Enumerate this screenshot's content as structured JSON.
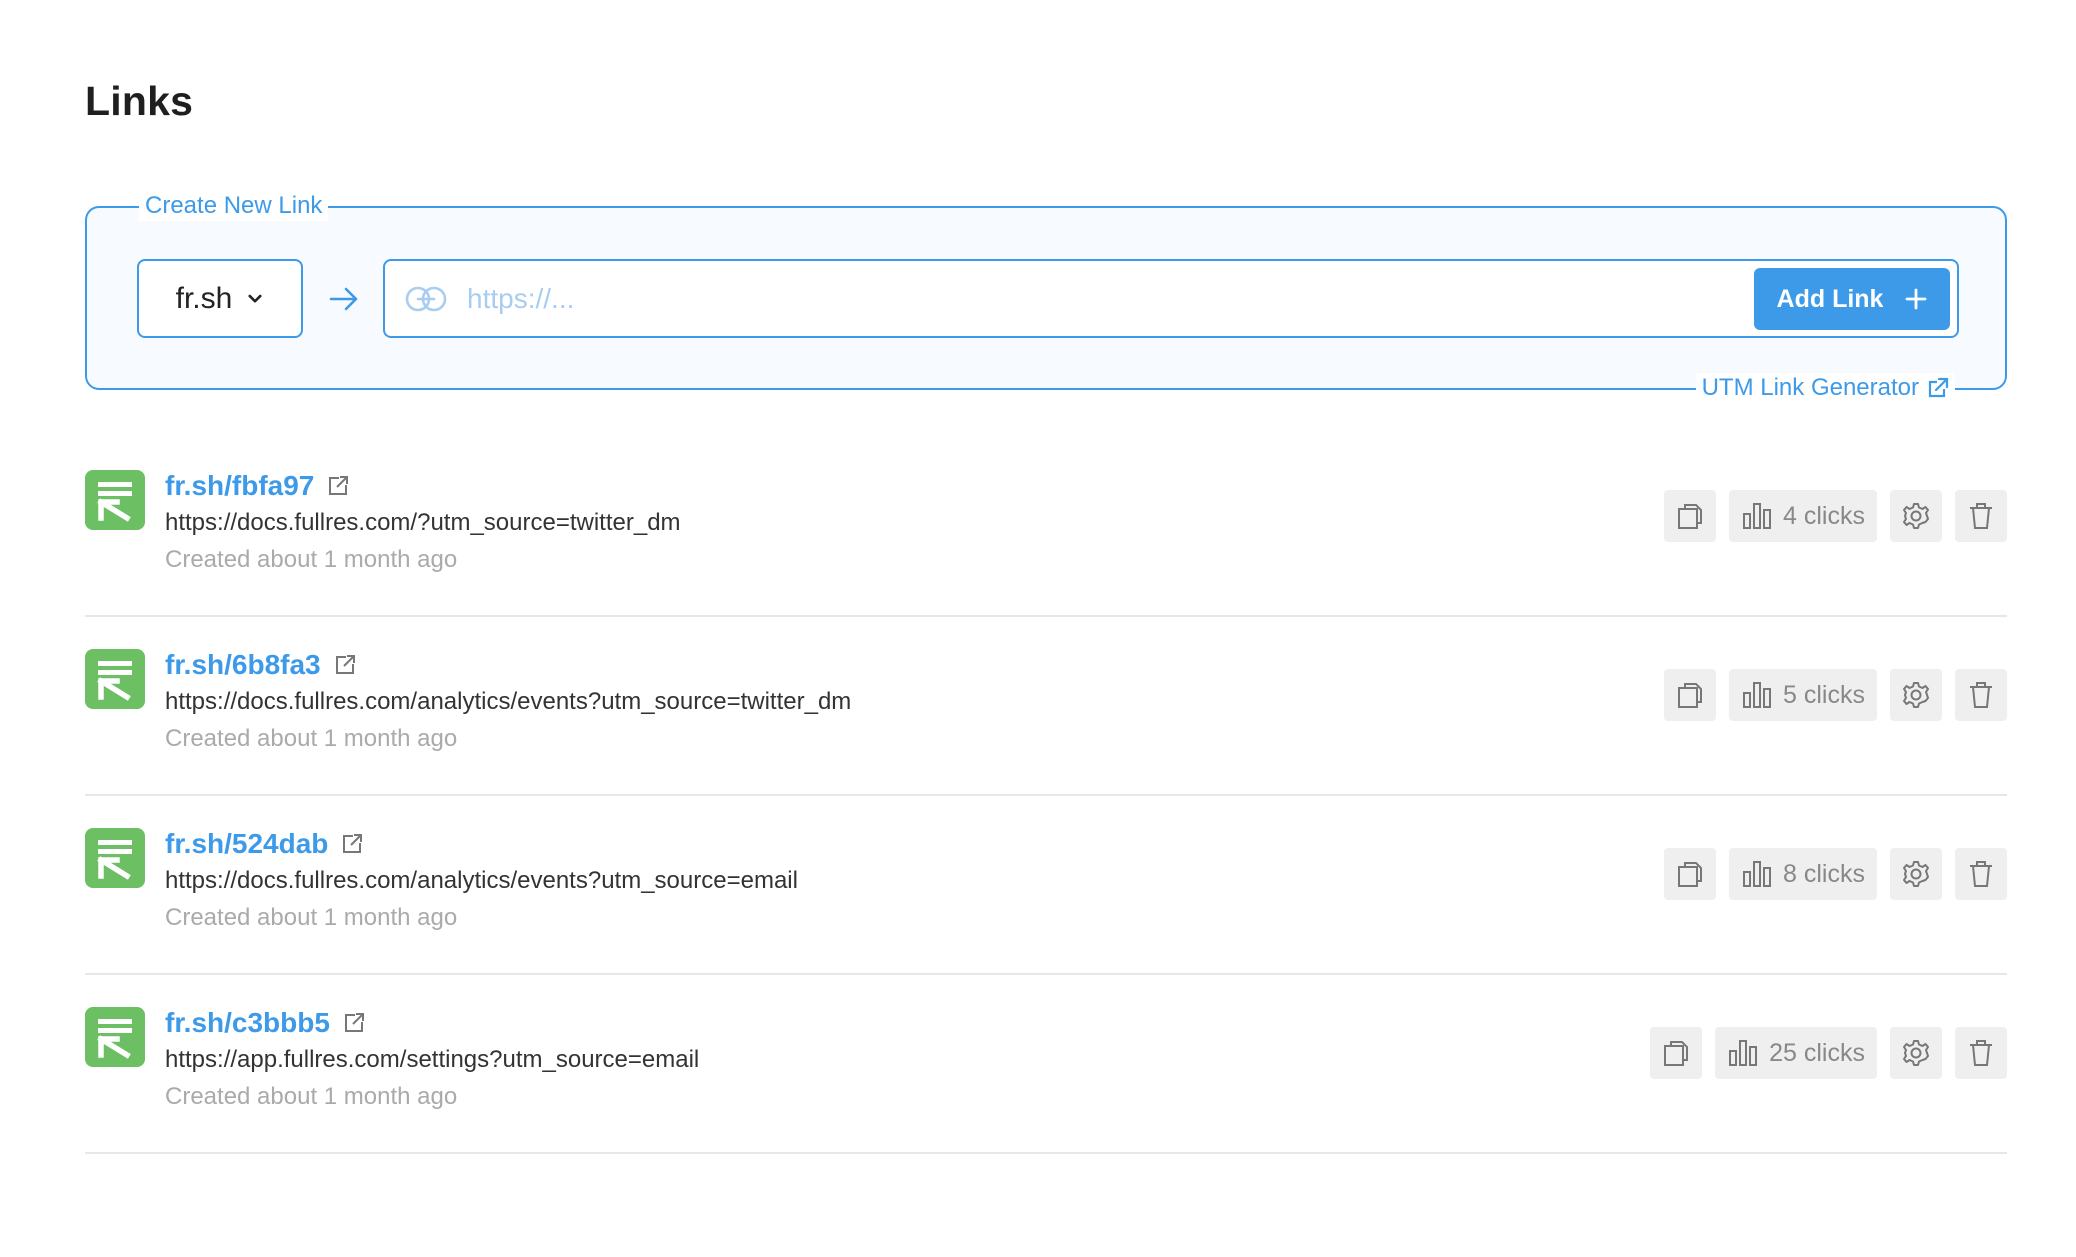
{
  "page": {
    "title": "Links"
  },
  "create": {
    "legend": "Create New Link",
    "domain_selected": "fr.sh",
    "url_placeholder": "https://...",
    "add_label": "Add Link",
    "utm_label": "UTM Link Generator"
  },
  "colors": {
    "accent": "#3d9ae8",
    "logo_green": "#6cbf63",
    "action_bg": "#efefef"
  },
  "links": [
    {
      "short": "fr.sh/fbfa97",
      "url": "https://docs.fullres.com/?utm_source=twitter_dm",
      "created": "Created about 1 month ago",
      "clicks": "4 clicks"
    },
    {
      "short": "fr.sh/6b8fa3",
      "url": "https://docs.fullres.com/analytics/events?utm_source=twitter_dm",
      "created": "Created about 1 month ago",
      "clicks": "5 clicks"
    },
    {
      "short": "fr.sh/524dab",
      "url": "https://docs.fullres.com/analytics/events?utm_source=email",
      "created": "Created about 1 month ago",
      "clicks": "8 clicks"
    },
    {
      "short": "fr.sh/c3bbb5",
      "url": "https://app.fullres.com/settings?utm_source=email",
      "created": "Created about 1 month ago",
      "clicks": "25 clicks"
    }
  ]
}
